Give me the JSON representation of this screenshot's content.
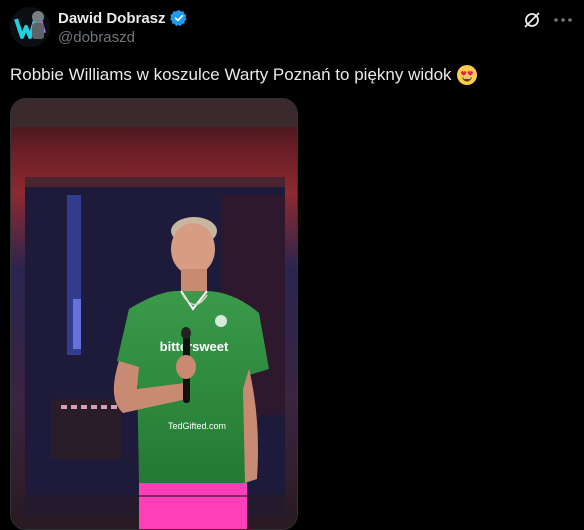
{
  "tweet": {
    "author_name": "Dawid Dobrasz",
    "author_handle": "@dobraszd",
    "text": "Robbie Williams w koszulce Warty Poznań to piękny widok",
    "emoji": "smiling-face-with-heart-eyes"
  },
  "media": {
    "shirt_sponsor": "bittersweet",
    "shirt_bottom_text": "TedGifted.com"
  },
  "icons": {
    "verified": "verified-badge-icon",
    "grok": "grok-icon",
    "more": "more-icon"
  },
  "colors": {
    "background": "#000000",
    "text": "#e7e9ea",
    "secondary_text": "#71767b",
    "verified_blue": "#1d9bf0",
    "shirt_green": "#2f8a3e",
    "shorts_pink": "#ff3fb8"
  }
}
